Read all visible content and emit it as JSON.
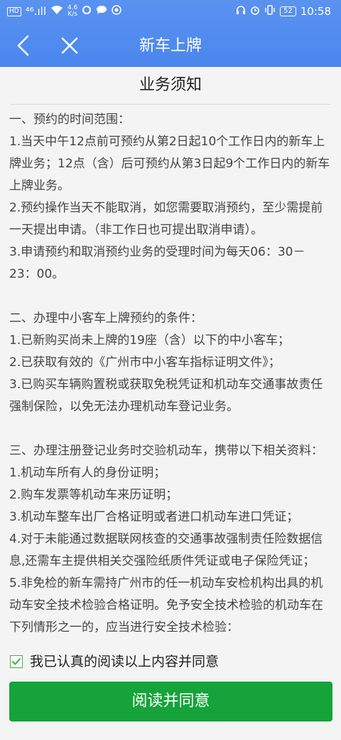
{
  "status_bar": {
    "hd": "HD",
    "signal": "⁴⁶.ıll",
    "speed_value": "4.6",
    "speed_unit": "K/s",
    "battery": "52",
    "time": "10:58"
  },
  "nav": {
    "title": "新车上牌"
  },
  "notice": {
    "title": "业务须知",
    "sections": [
      {
        "heading": "一、预约的时间范围：",
        "items": [
          "1.当天中午12点前可预约从第2日起10个工作日内的新车上牌业务；12点（含）后可预约从第3日起9个工作日内的新车上牌业务。",
          "2.预约操作当天不能取消，如您需要取消预约，至少需提前一天提出申请。（非工作日也可提出取消申请）。",
          "3.申请预约和取消预约业务的受理时间为每天06：30－23：00。"
        ]
      },
      {
        "heading": "二、办理中小客车上牌预约的条件：",
        "items": [
          "1.已新购买尚未上牌的19座（含）以下的中小客车；",
          "2.已获取有效的《广州市中小客车指标证明文件》；",
          "3.已购买车辆购置税或获取免税凭证和机动车交通事故责任强制保险，以免无法办理机动车登记业务。"
        ]
      },
      {
        "heading": "三、办理注册登记业务时交验机动车，携带以下相关资料：",
        "items": [
          "1.机动车所有人的身份证明；",
          "2.购车发票等机动车来历证明；",
          "3.机动车整车出厂合格证明或者进口机动车进口凭证；",
          "4.对于未能通过数据联网核查的交通事故强制责任险数据信息,还需车主提供相关交强险纸质件凭证或电子保险凭证；",
          "5.非免检的新车需持广州市的任一机动车安检机构出具的机动车安全技术检验合格证明。免予安全技术检验的机动车在下列情形之一的，应当进行安全技术检验："
        ]
      }
    ]
  },
  "agree": {
    "checked": true,
    "label": "我已认真的阅读以上内容并同意"
  },
  "confirm_button": {
    "label": "阅读并同意"
  },
  "colors": {
    "header": "#4a86ee",
    "button": "#15a33a",
    "checkmark": "#3cb043"
  }
}
